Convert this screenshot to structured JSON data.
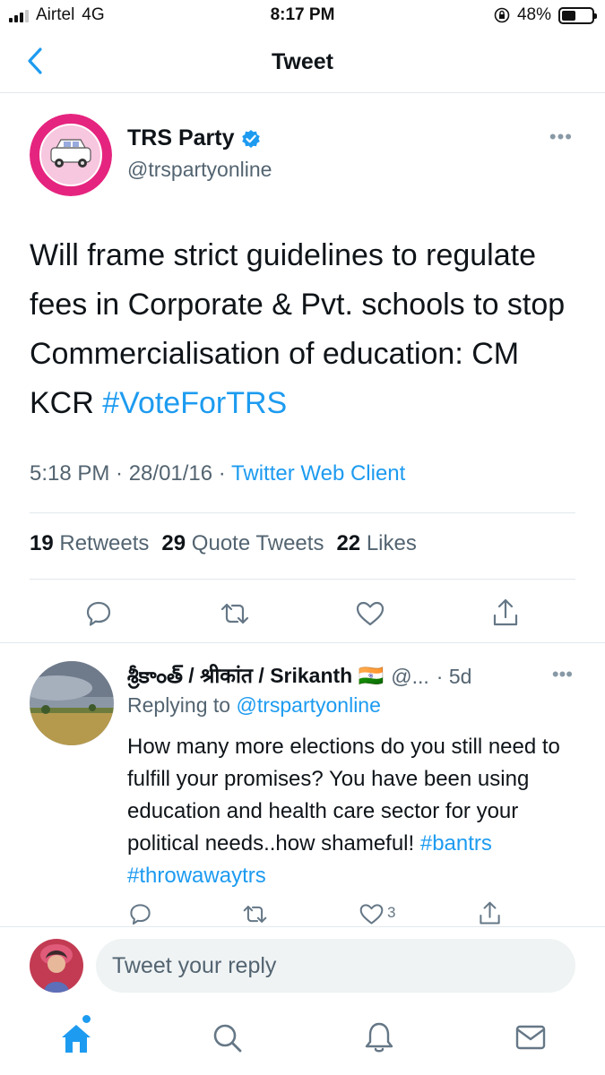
{
  "status_bar": {
    "carrier": "Airtel",
    "network": "4G",
    "time": "8:17 PM",
    "battery": "48%",
    "battery_level": 0.48
  },
  "nav": {
    "title": "Tweet",
    "back_icon": "chevron-left-icon"
  },
  "tweet": {
    "author_name": "TRS Party",
    "verified_icon": "verified-badge-icon",
    "handle": "@trspartyonline",
    "text": "Will frame strict guidelines to regulate fees in Corporate & Pvt. schools to stop Commercialisation of education: CM KCR ",
    "hashtag": "#VoteForTRS",
    "time_date": "5:18 PM · 28/01/16 · ",
    "source": "Twitter Web Client",
    "retweets_count": "19",
    "retweets_label": "Retweets",
    "quotes_count": "29",
    "quotes_label": "Quote Tweets",
    "likes_count": "22",
    "likes_label": "Likes"
  },
  "reply": {
    "name": "శ్రీకాంత్ / श्रीकांत / Srikanth 🇮🇳",
    "handle": "@...",
    "age": "· 5d",
    "replying_prefix": "Replying to ",
    "replying_to": "@trspartyonline",
    "text": "How many more elections do you still need to fulfill your promises? You have been using education and health care sector for your political needs..how shameful! ",
    "hashtags": "#bantrs #throwawaytrs",
    "like_count": "3"
  },
  "compose": {
    "placeholder": "Tweet your reply"
  },
  "colors": {
    "accent": "#1d9bf0",
    "muted": "#536471",
    "icon": "#657786"
  }
}
